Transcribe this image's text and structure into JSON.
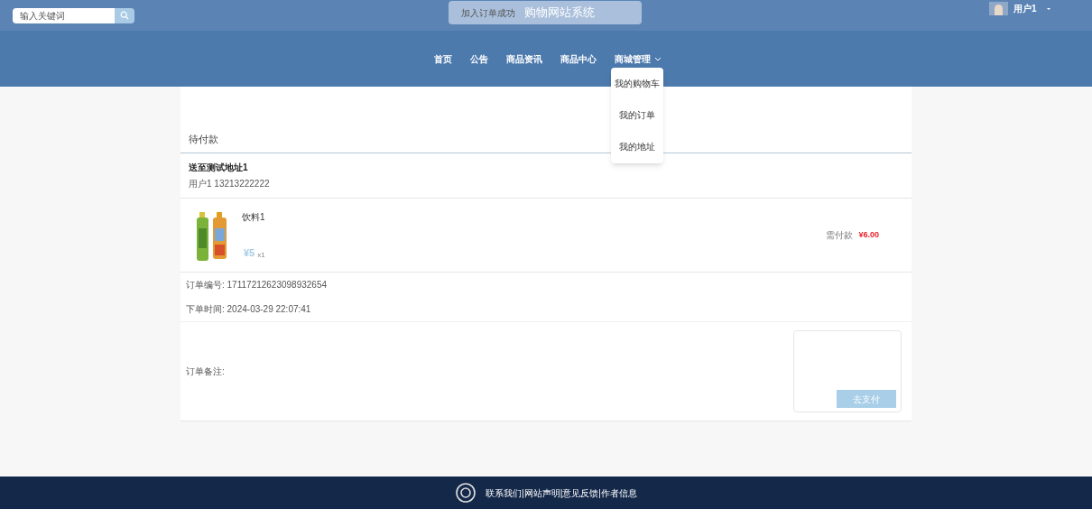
{
  "search": {
    "placeholder": "输入关键词"
  },
  "toast": {
    "text": "加入订单成功"
  },
  "site_title": "购物网站系统",
  "user": {
    "name": "用户1"
  },
  "nav": [
    {
      "label": "首页",
      "dropdown": false
    },
    {
      "label": "公告",
      "dropdown": false
    },
    {
      "label": "商品资讯",
      "dropdown": false
    },
    {
      "label": "商品中心",
      "dropdown": false
    },
    {
      "label": "商城管理",
      "dropdown": true,
      "expanded": true
    }
  ],
  "dropdown_menu": [
    "我的购物车",
    "我的订单",
    "我的地址"
  ],
  "order": {
    "status": "待付款",
    "address": {
      "title": "送至测试地址1",
      "contact": "用户1 13213222222"
    },
    "item": {
      "name": "饮料1",
      "price": "¥5",
      "quantity": "x1",
      "due_label": "需付款",
      "due": "¥6.00"
    },
    "info": [
      {
        "label": "订单编号:",
        "value": "17117212623098932654"
      },
      {
        "label": "下单时间:",
        "value": "2024-03-29 22:07:41"
      }
    ],
    "remark_label": "订单备注:",
    "pay_button": "去支付"
  },
  "footer": {
    "text": "联系我们|网站声明|意见反馈|作者信息"
  }
}
